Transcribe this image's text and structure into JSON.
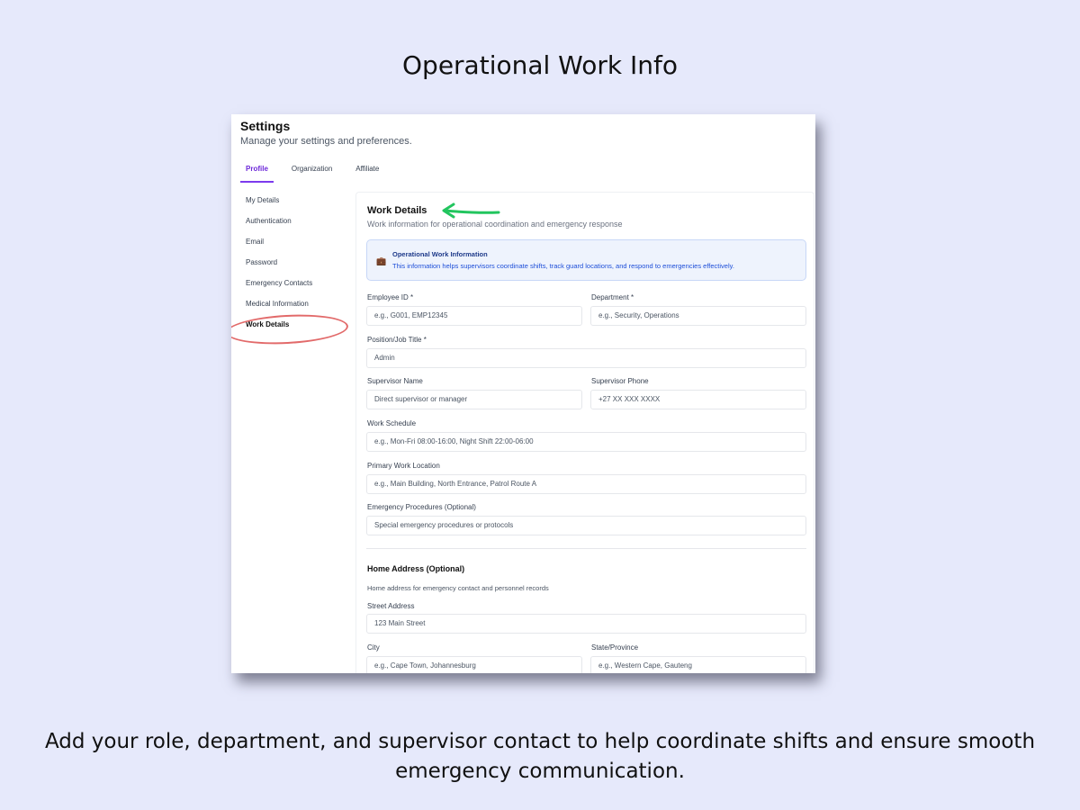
{
  "slide": {
    "title": "Operational Work Info",
    "caption": "Add your role, department, and supervisor contact to help coordinate shifts and ensure smooth emergency communication."
  },
  "settings": {
    "title": "Settings",
    "subtitle": "Manage your settings and preferences.",
    "tabs": [
      {
        "label": "Profile",
        "active": true
      },
      {
        "label": "Organization",
        "active": false
      },
      {
        "label": "Affiliate",
        "active": false
      }
    ],
    "sidebar": [
      {
        "label": "My Details"
      },
      {
        "label": "Authentication"
      },
      {
        "label": "Email"
      },
      {
        "label": "Password"
      },
      {
        "label": "Emergency Contacts"
      },
      {
        "label": "Medical Information"
      },
      {
        "label": "Work Details",
        "active": true
      }
    ]
  },
  "work_details": {
    "title": "Work Details",
    "subtitle": "Work information for operational coordination and emergency response",
    "info": {
      "icon": "briefcase-icon",
      "title": "Operational Work Information",
      "text": "This information helps supervisors coordinate shifts, track guard locations, and respond to emergencies effectively."
    },
    "fields": {
      "employee_id": {
        "label": "Employee ID *",
        "placeholder": "e.g., G001, EMP12345"
      },
      "department": {
        "label": "Department *",
        "placeholder": "e.g., Security, Operations"
      },
      "position": {
        "label": "Position/Job Title *",
        "value": "Admin"
      },
      "supervisor_name": {
        "label": "Supervisor Name",
        "placeholder": "Direct supervisor or manager"
      },
      "supervisor_phone": {
        "label": "Supervisor Phone",
        "placeholder": "+27 XX XXX XXXX"
      },
      "work_schedule": {
        "label": "Work Schedule",
        "placeholder": "e.g., Mon-Fri 08:00-16:00, Night Shift 22:00-06:00"
      },
      "primary_location": {
        "label": "Primary Work Location",
        "placeholder": "e.g., Main Building, North Entrance, Patrol Route A"
      },
      "emergency_procedures": {
        "label": "Emergency Procedures (Optional)",
        "placeholder": "Special emergency procedures or protocols"
      }
    }
  },
  "home_address": {
    "title": "Home Address (Optional)",
    "subtitle": "Home address for emergency contact and personnel records",
    "fields": {
      "street": {
        "label": "Street Address",
        "placeholder": "123 Main Street"
      },
      "city": {
        "label": "City",
        "placeholder": "e.g., Cape Town, Johannesburg"
      },
      "state": {
        "label": "State/Province",
        "placeholder": "e.g., Western Cape, Gauteng"
      }
    }
  },
  "colors": {
    "background": "#e6e9fb",
    "accent": "#7c3aed",
    "annotation_arrow": "#22c55e",
    "annotation_circle": "#e26a6a"
  }
}
